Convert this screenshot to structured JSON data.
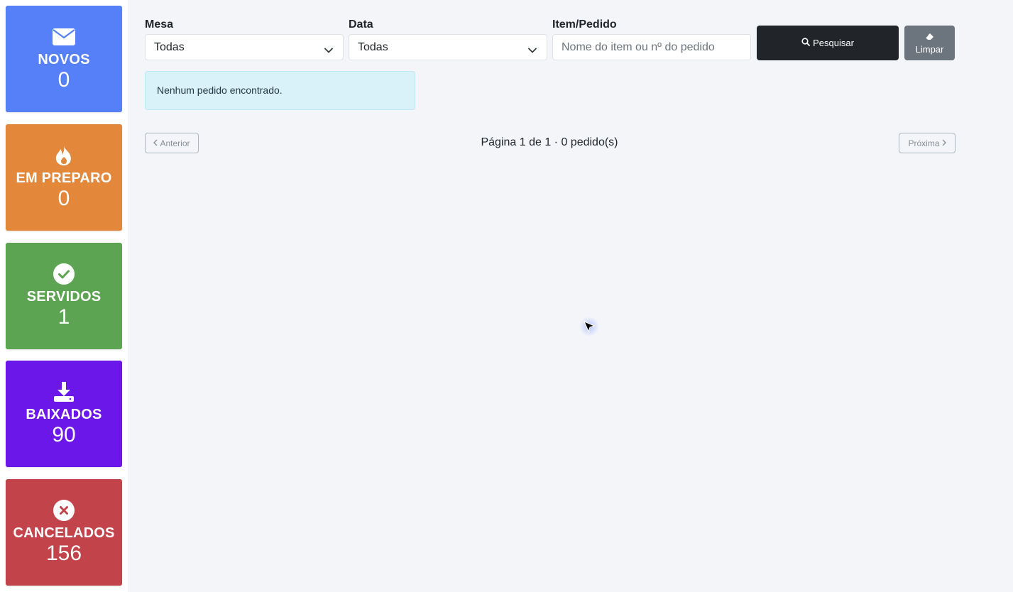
{
  "cards": [
    {
      "label": "NOVOS",
      "count": "0",
      "color": "#5580f7",
      "icon": "envelope-icon"
    },
    {
      "label": "EM PREPARO",
      "count": "0",
      "color": "#e3873a",
      "icon": "fire-icon"
    },
    {
      "label": "SERVIDOS",
      "count": "1",
      "color": "#5ca452",
      "icon": "check-circle-icon"
    },
    {
      "label": "BAIXADOS",
      "count": "90",
      "color": "#6b17ea",
      "icon": "download-icon"
    },
    {
      "label": "CANCELADOS",
      "count": "156",
      "color": "#c2434a",
      "icon": "x-circle-icon"
    }
  ],
  "filters": {
    "mesa_label": "Mesa",
    "mesa_value": "Todas",
    "data_label": "Data",
    "data_value": "Todas",
    "item_label": "Item/Pedido",
    "item_placeholder": "Nome do item ou nº do pedido",
    "item_value": "",
    "search_label": "Pesquisar",
    "clear_label": "Limpar"
  },
  "results": {
    "empty_message": "Nenhum pedido encontrado."
  },
  "pagination": {
    "prev_label": "Anterior",
    "next_label": "Próxima",
    "info": "Página 1 de 1 · 0 pedido(s)"
  }
}
